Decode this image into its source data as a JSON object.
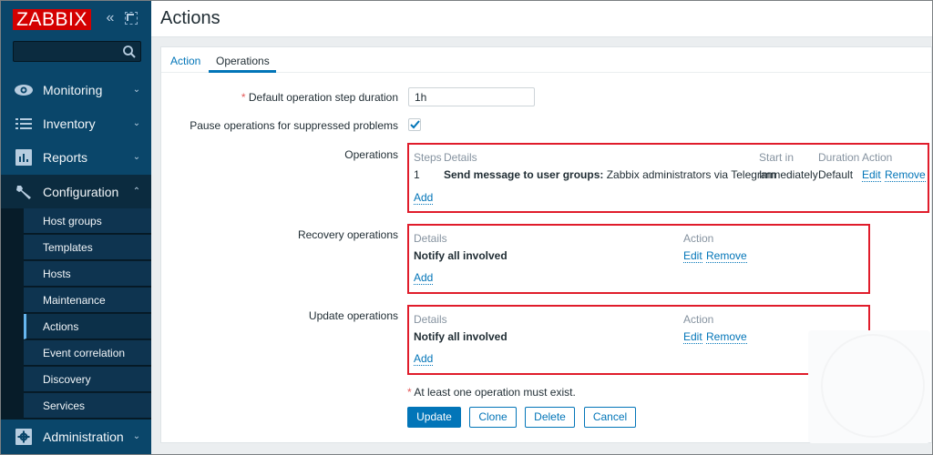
{
  "sidebar": {
    "logo": "ZABBIX",
    "collapse_icon": "«",
    "search": {
      "value": "",
      "placeholder": ""
    },
    "menu": [
      {
        "label": "Monitoring",
        "icon": "eye-icon",
        "chevron": "⌄"
      },
      {
        "label": "Inventory",
        "icon": "list-icon",
        "chevron": "⌄"
      },
      {
        "label": "Reports",
        "icon": "bar-chart-icon",
        "chevron": "⌄"
      },
      {
        "label": "Configuration",
        "icon": "wrench-icon",
        "chevron": "⌃"
      },
      {
        "label": "Administration",
        "icon": "gear-icon",
        "chevron": "⌄"
      }
    ],
    "submenu": [
      {
        "label": "Host groups"
      },
      {
        "label": "Templates"
      },
      {
        "label": "Hosts"
      },
      {
        "label": "Maintenance"
      },
      {
        "label": "Actions"
      },
      {
        "label": "Event correlation"
      },
      {
        "label": "Discovery"
      },
      {
        "label": "Services"
      }
    ]
  },
  "header": {
    "title": "Actions"
  },
  "tabs": [
    {
      "label": "Action"
    },
    {
      "label": "Operations"
    }
  ],
  "form": {
    "step_duration": {
      "required_mark": "*",
      "label": "Default operation step duration",
      "value": "1h"
    },
    "pause_suppressed": {
      "label": "Pause operations for suppressed problems",
      "checked": true
    },
    "operations": {
      "label": "Operations",
      "columns": [
        "Steps",
        "Details",
        "Start in",
        "Duration",
        "Action"
      ],
      "rows": [
        {
          "steps": "1",
          "details_bold": "Send message to user groups:",
          "details_rest": " Zabbix administrators via Telegram",
          "start_in": "Immediately",
          "duration": "Default",
          "edit": "Edit",
          "remove": "Remove"
        }
      ],
      "add": "Add"
    },
    "recovery_operations": {
      "label": "Recovery operations",
      "columns": [
        "Details",
        "Action"
      ],
      "rows": [
        {
          "details": "Notify all involved",
          "edit": "Edit",
          "remove": "Remove"
        }
      ],
      "add": "Add"
    },
    "update_operations": {
      "label": "Update operations",
      "columns": [
        "Details",
        "Action"
      ],
      "rows": [
        {
          "details": "Notify all involved",
          "edit": "Edit",
          "remove": "Remove"
        }
      ],
      "add": "Add"
    },
    "note": {
      "required_mark": "*",
      "text": " At least one operation must exist."
    },
    "buttons": {
      "update": "Update",
      "clone": "Clone",
      "delete": "Delete",
      "cancel": "Cancel"
    }
  },
  "colors": {
    "sidebar_bg": "#0a466a",
    "accent": "#0275b8",
    "logo_red": "#d40000",
    "highlight_border": "#e01c2b",
    "required": "#e45959"
  }
}
